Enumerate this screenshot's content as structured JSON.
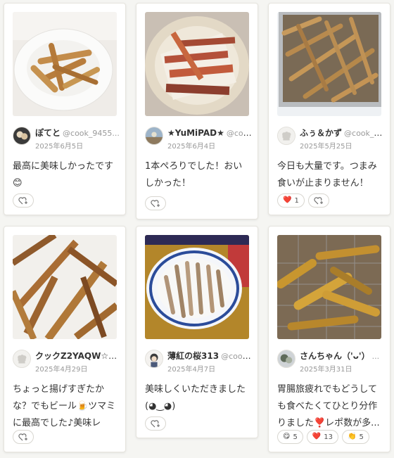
{
  "cards": [
    {
      "name": "ぽてと",
      "id": "@cook_9455...",
      "date": "2025年6月5日",
      "comment": "最高に美味しかったです😊",
      "reactions": []
    },
    {
      "name": "★YuMiPAD★",
      "id": "@coo...",
      "date": "2025年6月4日",
      "comment": "1本ぺろりでした！おいしかった！",
      "reactions": []
    },
    {
      "name": "ふぅ＆かず",
      "id": "@cook_4...",
      "date": "2025年5月25日",
      "comment": "今日も大量です。つまみ食いが止まりません！",
      "reactions": [
        {
          "icon": "heart-icon",
          "glyph": "❤️",
          "count": "1"
        }
      ]
    },
    {
      "name": "クックZ2YAQW☆",
      "id": "@...",
      "date": "2025年4月29日",
      "comment": "ちょっと揚げすぎたかな？でもビール🍺ツマミに最高でした♪美味レシ...",
      "reactions": []
    },
    {
      "name": "薄紅の桜313",
      "id": "@cook...",
      "date": "2025年4月7日",
      "comment": "美味しくいただきました(◕‿◕)",
      "reactions": []
    },
    {
      "name": "さんちゃん（'ᴗ'）",
      "id": "...",
      "date": "2025年3月31日",
      "comment": "胃腸旅疲れでもどうしても食べたくてひとり分作りました❣️レポ数が多...",
      "reactions": [
        {
          "icon": "smile-icon",
          "glyph": "😋",
          "count": "5"
        },
        {
          "icon": "heart-icon",
          "glyph": "❤️",
          "count": "13"
        },
        {
          "icon": "clap-icon",
          "glyph": "👏",
          "count": "5"
        }
      ]
    }
  ],
  "colors": {
    "card_bg": "#ffffff",
    "page_bg": "#f5f5f2",
    "name_text": "#333333",
    "meta_text": "#999999",
    "reaction_border": "#d8d6d0"
  }
}
